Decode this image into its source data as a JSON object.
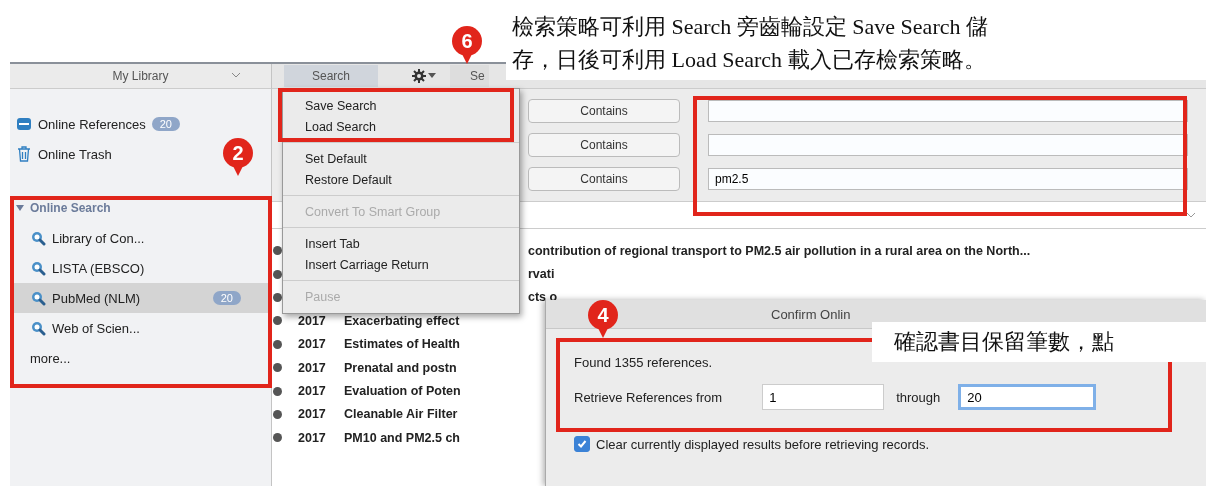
{
  "callouts": [
    {
      "lines": [
        "檢索策略可利用 Search 旁齒輪設定 Save Search 儲",
        "存，日後可利用 Load Search 載入已存檢索策略。"
      ]
    },
    {
      "lines": [
        "確認書目保留筆數，點"
      ]
    }
  ],
  "markers": [
    {
      "label": "6"
    },
    {
      "label": "2"
    },
    {
      "label": "4"
    }
  ],
  "sidebar": {
    "header": "My Library",
    "items": [
      {
        "kind": "collection",
        "label": "Online References",
        "badge": "20",
        "selected": false
      },
      {
        "kind": "trash",
        "label": "Online Trash",
        "selected": false
      },
      {
        "kind": "group",
        "label": "Online Search",
        "expanded": true,
        "selected": false
      },
      {
        "kind": "online",
        "label": "Library of Con...",
        "selected": false
      },
      {
        "kind": "online",
        "label": "LISTA (EBSCO)",
        "selected": false
      },
      {
        "kind": "online",
        "label": "PubMed (NLM)",
        "badge": "20",
        "selected": true
      },
      {
        "kind": "online",
        "label": "Web of Scien...",
        "selected": false
      },
      {
        "kind": "more",
        "label": "more...",
        "selected": false
      }
    ]
  },
  "toolbar": {
    "tabs": [
      {
        "label": "Search",
        "selected": true
      },
      {
        "label": "Se",
        "selected": false
      }
    ]
  },
  "search_rows": [
    {
      "condition": "Contains"
    },
    {
      "condition": "Contains"
    },
    {
      "condition": "Contains",
      "value": "pm2.5"
    }
  ],
  "menu": [
    {
      "kind": "item",
      "label": "Save Search",
      "disabled": false
    },
    {
      "kind": "item",
      "label": "Load Search",
      "disabled": false
    },
    {
      "kind": "separator"
    },
    {
      "kind": "item",
      "label": "Set Default",
      "disabled": false
    },
    {
      "kind": "item",
      "label": "Restore Default",
      "disabled": false
    },
    {
      "kind": "separator"
    },
    {
      "kind": "item",
      "label": "Convert To Smart Group",
      "disabled": true
    },
    {
      "kind": "separator"
    },
    {
      "kind": "item",
      "label": "Insert Tab",
      "disabled": false
    },
    {
      "kind": "item",
      "label": "Insert Carriage Return",
      "disabled": false
    },
    {
      "kind": "separator"
    },
    {
      "kind": "item",
      "label": "Pause",
      "disabled": true
    }
  ],
  "references": [
    {
      "title": "contribution of regional transport to PM2.5 air pollution in a rural area on the North..."
    },
    {
      "title": "rvati"
    },
    {
      "title": "cts o"
    },
    {
      "year": "2017",
      "title": "Exacerbating effect"
    },
    {
      "year": "2017",
      "title": "Estimates of Health"
    },
    {
      "year": "2017",
      "title": "Prenatal and postn"
    },
    {
      "year": "2017",
      "title": "Evaluation of Poten"
    },
    {
      "year": "2017",
      "title": "Cleanable Air Filter"
    },
    {
      "year": "2017",
      "title": "PM10 and PM2.5 ch"
    }
  ],
  "dialog": {
    "title": "Confirm Onlin",
    "found": "Found 1355 references.",
    "from_label": "Retrieve References from",
    "from_value": "1",
    "through_label": "through",
    "through_value": "20",
    "option": {
      "label": "Clear currently displayed results before retrieving records.",
      "checked": true
    }
  }
}
